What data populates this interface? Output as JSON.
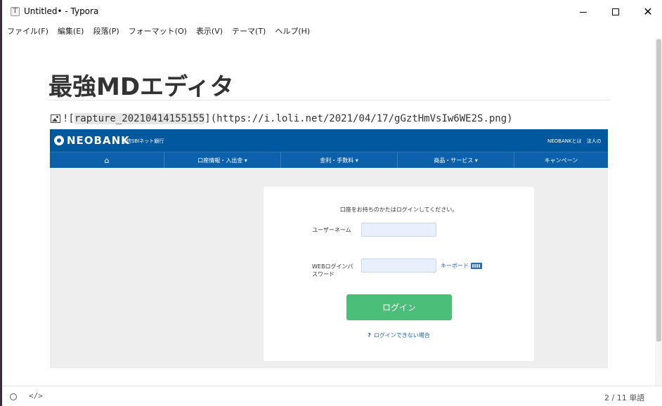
{
  "window": {
    "app_icon": "T",
    "title": "Untitled• - Typora"
  },
  "menu": [
    "ファイル(F)",
    "編集(E)",
    "段落(P)",
    "フォーマット(O)",
    "表示(V)",
    "テーマ(T)",
    "ヘルプ(H)"
  ],
  "document": {
    "heading": "最強MDエディタ",
    "image_markdown": {
      "prefix": "![",
      "alt": "rapture_20210414155155",
      "suffix": "](https://i.loli.net/2021/04/17/gGztHmVsIw6WE2S.png)"
    }
  },
  "embedded_image": {
    "brand": "NEOBANK",
    "brand_sub": "住信SBIネット銀行",
    "top_links": "NEOBANKとは　法人の",
    "nav": [
      "⌂",
      "口座情報・入出金 ▾",
      "金利・手数料 ▾",
      "商品・サービス ▾",
      "キャンペーン"
    ],
    "login": {
      "note": "口座をお持ちのかたはログインしてください。",
      "username_label": "ユーザーネーム",
      "password_label": "WEBログインパスワード",
      "keyboard_link": "キーボード",
      "login_button": "ログイン",
      "help_link": "ログインできない場合",
      "help_icon": "?"
    },
    "colors": {
      "header_blue": "#00589f",
      "button_green": "#4bbf7a",
      "link_blue": "#1a63c0"
    }
  },
  "statusbar": {
    "source_toggle": "</>",
    "word_count": "2 / 11 単語"
  },
  "icons": {
    "app": "typora-icon",
    "image": "image-icon",
    "minimize": "minimize-icon",
    "maximize": "maximize-icon",
    "close": "close-icon",
    "home": "home-icon",
    "keyboard": "keyboard-icon",
    "outline": "outline-circle-icon",
    "source": "source-code-icon"
  }
}
